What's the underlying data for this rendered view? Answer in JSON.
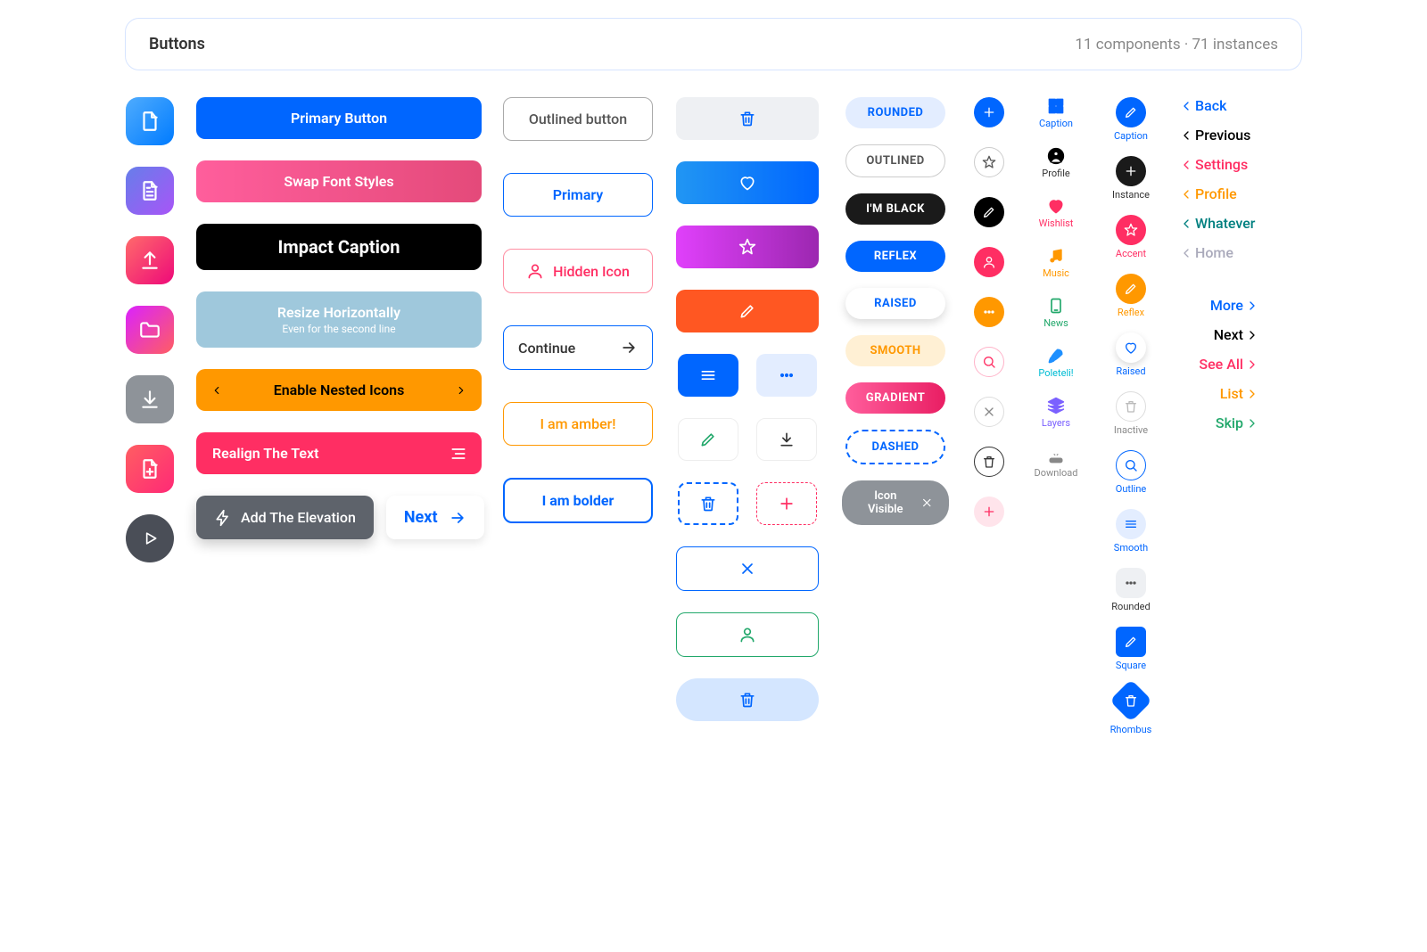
{
  "header": {
    "title": "Buttons",
    "meta": "11 components · 71 instances"
  },
  "col2": {
    "primary": "Primary Button",
    "swap": "Swap Font Styles",
    "impact": "Impact Caption",
    "resize": "Resize Horizontally",
    "resize_sub": "Even for the second line",
    "nested": "Enable Nested Icons",
    "realign": "Realign The Text",
    "elevation": "Add The Elevation",
    "next": "Next"
  },
  "col3": {
    "outlined": "Outlined button",
    "primary": "Primary",
    "hidden": "Hidden Icon",
    "continue": "Continue",
    "amber": "I am amber!",
    "bolder": "I am bolder"
  },
  "col5": {
    "rounded": "ROUNDED",
    "outlined": "OUTLINED",
    "black": "I'M BLACK",
    "reflex": "REFLEX",
    "raised": "RAISED",
    "smooth": "SMOOTH",
    "gradient": "GRADIENT",
    "dashed": "DASHED",
    "iconv": "Icon Visible"
  },
  "col7": {
    "caption": "Caption",
    "profile": "Profile",
    "wishlist": "Wishlist",
    "music": "Music",
    "news": "News",
    "poleteli": "Poleteli!",
    "layers": "Layers",
    "download": "Download"
  },
  "col8": {
    "caption": "Caption",
    "instance": "Instance",
    "accent": "Accent",
    "reflex": "Reflex",
    "raised": "Raised",
    "inactive": "Inactive",
    "outline": "Outline",
    "smooth": "Smooth",
    "rounded": "Rounded",
    "square": "Square",
    "rhombus": "Rhombus"
  },
  "col9": {
    "back": "Back",
    "previous": "Previous",
    "settings": "Settings",
    "profile": "Profile",
    "whatever": "Whatever",
    "home": "Home",
    "more": "More",
    "next": "Next",
    "seeall": "See All",
    "list": "List",
    "skip": "Skip"
  }
}
